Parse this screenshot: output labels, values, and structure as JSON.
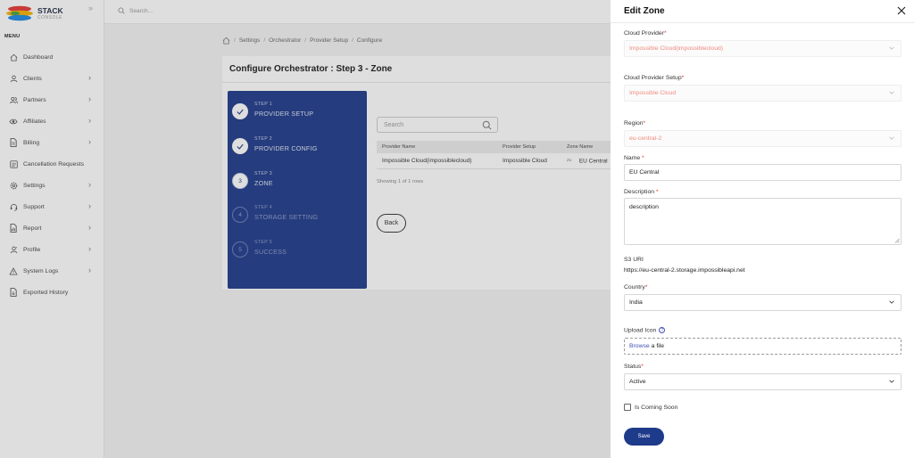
{
  "brand": {
    "name": "STACK",
    "sub": "CONSOLE"
  },
  "sidebar": {
    "menu_title": "MENU",
    "items": [
      {
        "label": "Dashboard",
        "icon": "home-icon",
        "chevron": false
      },
      {
        "label": "Clients",
        "icon": "user-icon",
        "chevron": true
      },
      {
        "label": "Partners",
        "icon": "users-icon",
        "chevron": true
      },
      {
        "label": "Affiliates",
        "icon": "eye-icon",
        "chevron": true
      },
      {
        "label": "Billing",
        "icon": "file-icon",
        "chevron": true
      },
      {
        "label": "Cancellation Requests",
        "icon": "list-icon",
        "chevron": false
      },
      {
        "label": "Settings",
        "icon": "gear-icon",
        "chevron": true
      },
      {
        "label": "Support",
        "icon": "headset-icon",
        "chevron": true
      },
      {
        "label": "Report",
        "icon": "report-icon",
        "chevron": true
      },
      {
        "label": "Profile",
        "icon": "profile-icon",
        "chevron": true
      },
      {
        "label": "System Logs",
        "icon": "warning-icon",
        "chevron": true
      },
      {
        "label": "Exported History",
        "icon": "export-icon",
        "chevron": false
      }
    ]
  },
  "topbar": {
    "search_placeholder": "Search..."
  },
  "breadcrumb": [
    "Settings",
    "Orchestrator",
    "Provider Setup",
    "Configure"
  ],
  "page": {
    "title": "Configure Orchestrator : Step 3 - Zone",
    "steps": [
      {
        "label": "STEP 1",
        "name": "PROVIDER SETUP",
        "state": "done",
        "marker": ""
      },
      {
        "label": "STEP 2",
        "name": "PROVIDER CONFIG",
        "state": "done",
        "marker": ""
      },
      {
        "label": "STEP 3",
        "name": "ZONE",
        "state": "active",
        "marker": "3"
      },
      {
        "label": "STEP 4",
        "name": "STORAGE SETTING",
        "state": "pending",
        "marker": "4"
      },
      {
        "label": "STEP 5",
        "name": "SUCCESS",
        "state": "pending",
        "marker": "5"
      }
    ],
    "table_search_placeholder": "Search",
    "columns": [
      "Provider Name",
      "Provider Setup",
      "Zone Name"
    ],
    "rows": [
      {
        "provider_name": "Impossible Cloud(impossiblecloud)",
        "provider_setup": "Impossible Cloud",
        "zone_img_alt": "Zo",
        "zone_name": "EU Central"
      }
    ],
    "showing": "Showing 1 of 1 rows",
    "back_label": "Back"
  },
  "panel": {
    "title": "Edit Zone",
    "cloud_provider": {
      "label": "Cloud Provider",
      "value": "Impossible Cloud(impossiblecloud)"
    },
    "cloud_provider_setup": {
      "label": "Cloud Provider Setup",
      "value": "Impossible Cloud"
    },
    "region": {
      "label": "Region",
      "value": "eu-central-2"
    },
    "name": {
      "label": "Name ",
      "value": "EU Central"
    },
    "description": {
      "label": "Description ",
      "value": "description"
    },
    "s3_uri": {
      "label": "S3 URI",
      "value": "https://eu-central-2.storage.impossibleapi.net"
    },
    "country": {
      "label": "Country",
      "value": "India"
    },
    "upload_icon": {
      "label": "Upload Icon",
      "link": "Browse",
      "text": "a file"
    },
    "status": {
      "label": "Status",
      "value": "Active"
    },
    "coming_soon_label": "Is Coming Soon",
    "save_label": "Save",
    "required_mark": "*"
  },
  "colors": {
    "primary": "#1e3a8a",
    "required": "#e53935",
    "disabled_text": "#f08a7e"
  }
}
